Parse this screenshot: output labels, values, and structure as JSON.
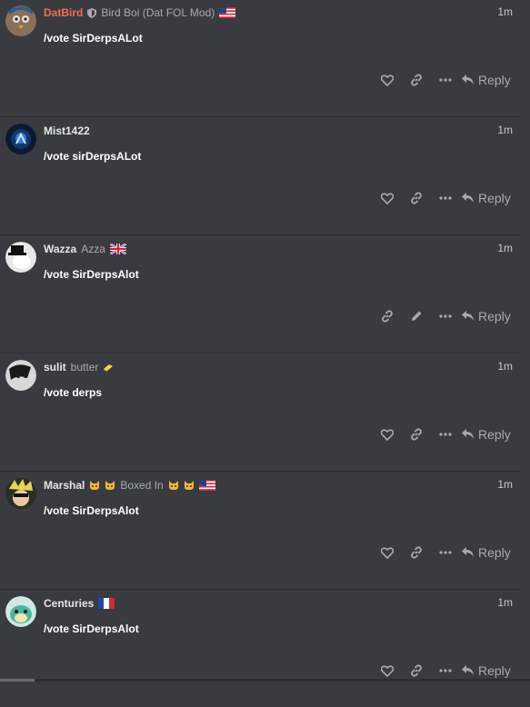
{
  "colors": {
    "background": "#3a3b40",
    "mod_name": "#f06e55",
    "muted": "#a9a9ad"
  },
  "posts": [
    {
      "username": "DatBird",
      "title": "Bird Boi (Dat FOL Mod)",
      "time": "1m",
      "body": "/vote SirDerpsALot",
      "reply": "Reply",
      "flag": "us-flag"
    },
    {
      "username": "Mist1422",
      "time": "1m",
      "body": "/vote sirDerpsALot",
      "reply": "Reply"
    },
    {
      "username": "Wazza",
      "title": "Azza",
      "time": "1m",
      "body": "/vote SirDerpsAlot",
      "reply": "Reply",
      "flag": "uk-flag"
    },
    {
      "username": "sulit",
      "title": "butter",
      "time": "1m",
      "body": "/vote derps",
      "reply": "Reply"
    },
    {
      "username": "Marshal",
      "title": "Boxed In",
      "time": "1m",
      "body": "/vote SirDerpsAlot",
      "reply": "Reply",
      "flag": "us-flag"
    },
    {
      "username": "Centuries",
      "time": "1m",
      "body": "/vote SirDerpsAlot",
      "reply": "Reply",
      "flag": "fr-flag"
    }
  ]
}
